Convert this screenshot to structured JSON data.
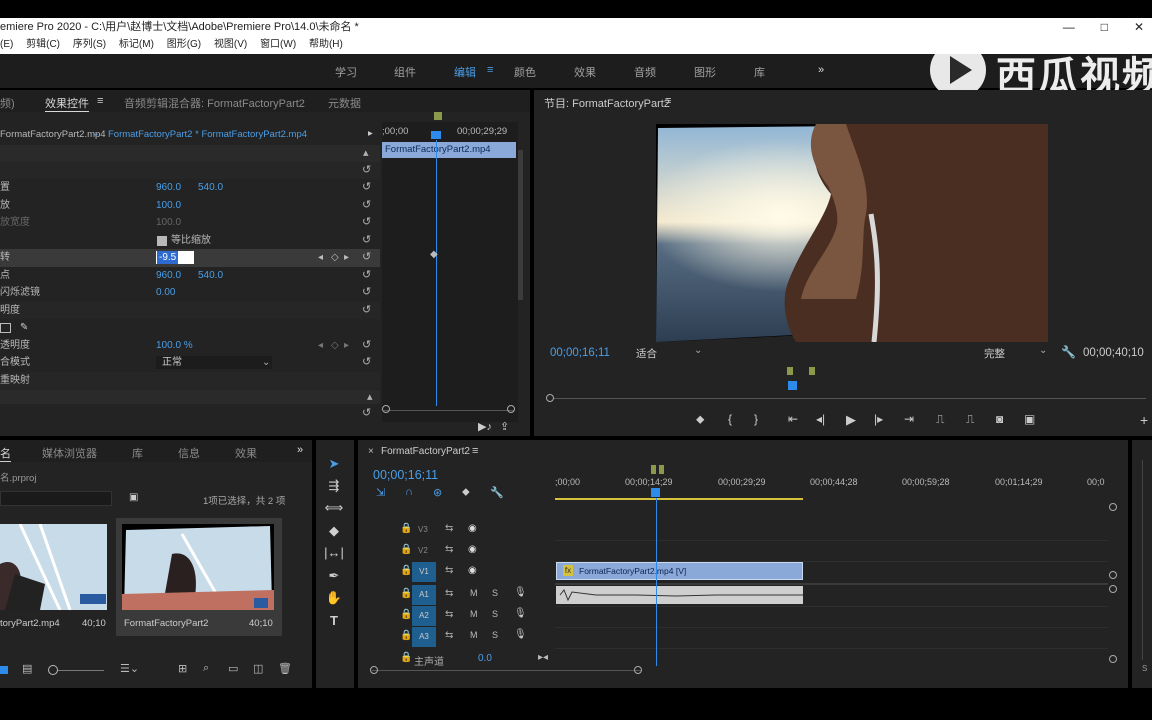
{
  "window": {
    "title": "emiere Pro 2020 - C:\\用户\\赵博士\\文档\\Adobe\\Premiere Pro\\14.0\\未命名 *",
    "controls": [
      "—",
      "□",
      "✕"
    ]
  },
  "menu": [
    "(E)",
    "剪辑(C)",
    "序列(S)",
    "标记(M)",
    "图形(G)",
    "视图(V)",
    "窗口(W)",
    "帮助(H)"
  ],
  "workspaces": {
    "items": [
      "学习",
      "组件",
      "编辑",
      "颜色",
      "效果",
      "音频",
      "图形",
      "库"
    ],
    "active": "编辑",
    "more": "»"
  },
  "watermark": "西瓜视频",
  "effect_controls": {
    "tabs": [
      "频)",
      "效果控件",
      "音频剪辑混合器: FormatFactoryPart2",
      "元数据"
    ],
    "source_clip": "FormatFactoryPart2.mp4",
    "sequence_clip": "FormatFactoryPart2 * FormatFactoryPart2.mp4",
    "time_start": ";00;00",
    "time_end": "00;00;29;29",
    "clip_bar": "FormatFactoryPart2.mp4",
    "properties": [
      {
        "label": "置",
        "v1": "960.0",
        "v2": "540.0"
      },
      {
        "label": "放",
        "v1": "100.0",
        "v2": ""
      },
      {
        "label": "放宽度",
        "v1": "100.0",
        "v2": ""
      },
      {
        "label": "",
        "v1": "等比缩放",
        "v2": ""
      },
      {
        "label": "转",
        "v1": "-9.5",
        "v2": ""
      },
      {
        "label": "点",
        "v1": "960.0",
        "v2": "540.0"
      },
      {
        "label": "闪烁滤镜",
        "v1": "0.00",
        "v2": ""
      },
      {
        "label": "明度",
        "v1": "",
        "v2": ""
      },
      {
        "label": "",
        "v1": "",
        "v2": ""
      },
      {
        "label": "透明度",
        "v1": "100.0 %",
        "v2": ""
      },
      {
        "label": "合模式",
        "v1": "正常",
        "v2": ""
      },
      {
        "label": "重映射",
        "v1": "",
        "v2": ""
      }
    ]
  },
  "program_monitor": {
    "title": "节目: FormatFactoryPart2",
    "timecode": "00;00;16;11",
    "fit": "适合",
    "quality": "完整",
    "duration": "00;00;40;10"
  },
  "project": {
    "tabs": [
      "名",
      "媒体浏览器",
      "库",
      "信息",
      "效果"
    ],
    "file": "名.prproj",
    "selection": "1项已选择，共 2 项",
    "items": [
      {
        "name": "toryPart2.mp4",
        "duration": "40;10"
      },
      {
        "name": "FormatFactoryPart2",
        "duration": "40;10"
      }
    ]
  },
  "timeline": {
    "tab": "FormatFactoryPart2",
    "timecode": "00;00;16;11",
    "ruler": [
      ";00;00",
      "00;00;14;29",
      "00;00;29;29",
      "00;00;44;28",
      "00;00;59;28",
      "00;01;14;29",
      "00;0"
    ],
    "video_tracks": [
      "V3",
      "V2",
      "V1"
    ],
    "audio_tracks": [
      "A1",
      "A2",
      "A3"
    ],
    "master_label": "主声道",
    "master_value": "0.0",
    "video_clip": "FormatFactoryPart2.mp4 [V]",
    "fx_badge": "fx"
  },
  "colors": {
    "accent": "#2d8ceb",
    "panel": "#232323",
    "clip_video": "#8aa8d8",
    "track_active": "#1f5f8f"
  }
}
